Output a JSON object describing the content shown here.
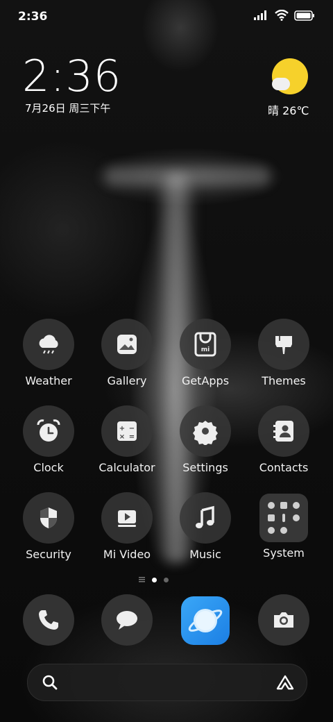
{
  "status_bar": {
    "time": "2:36"
  },
  "clock_widget": {
    "time": "2:36",
    "date": "7月26日 周三下午"
  },
  "weather_widget": {
    "text": "晴 26℃"
  },
  "apps": [
    {
      "label": "Weather"
    },
    {
      "label": "Gallery"
    },
    {
      "label": "GetApps"
    },
    {
      "label": "Themes"
    },
    {
      "label": "Clock"
    },
    {
      "label": "Calculator"
    },
    {
      "label": "Settings"
    },
    {
      "label": "Contacts"
    },
    {
      "label": "Security"
    },
    {
      "label": "Mi Video"
    },
    {
      "label": "Music"
    },
    {
      "label": "System"
    }
  ],
  "dock": [
    "phone-icon",
    "messages-icon",
    "browser-icon",
    "camera-icon"
  ],
  "search": {
    "placeholder": ""
  },
  "colors": {
    "sun": "#f6d12b",
    "browser": "#2d9cf2",
    "icon_bg": "#373737"
  }
}
